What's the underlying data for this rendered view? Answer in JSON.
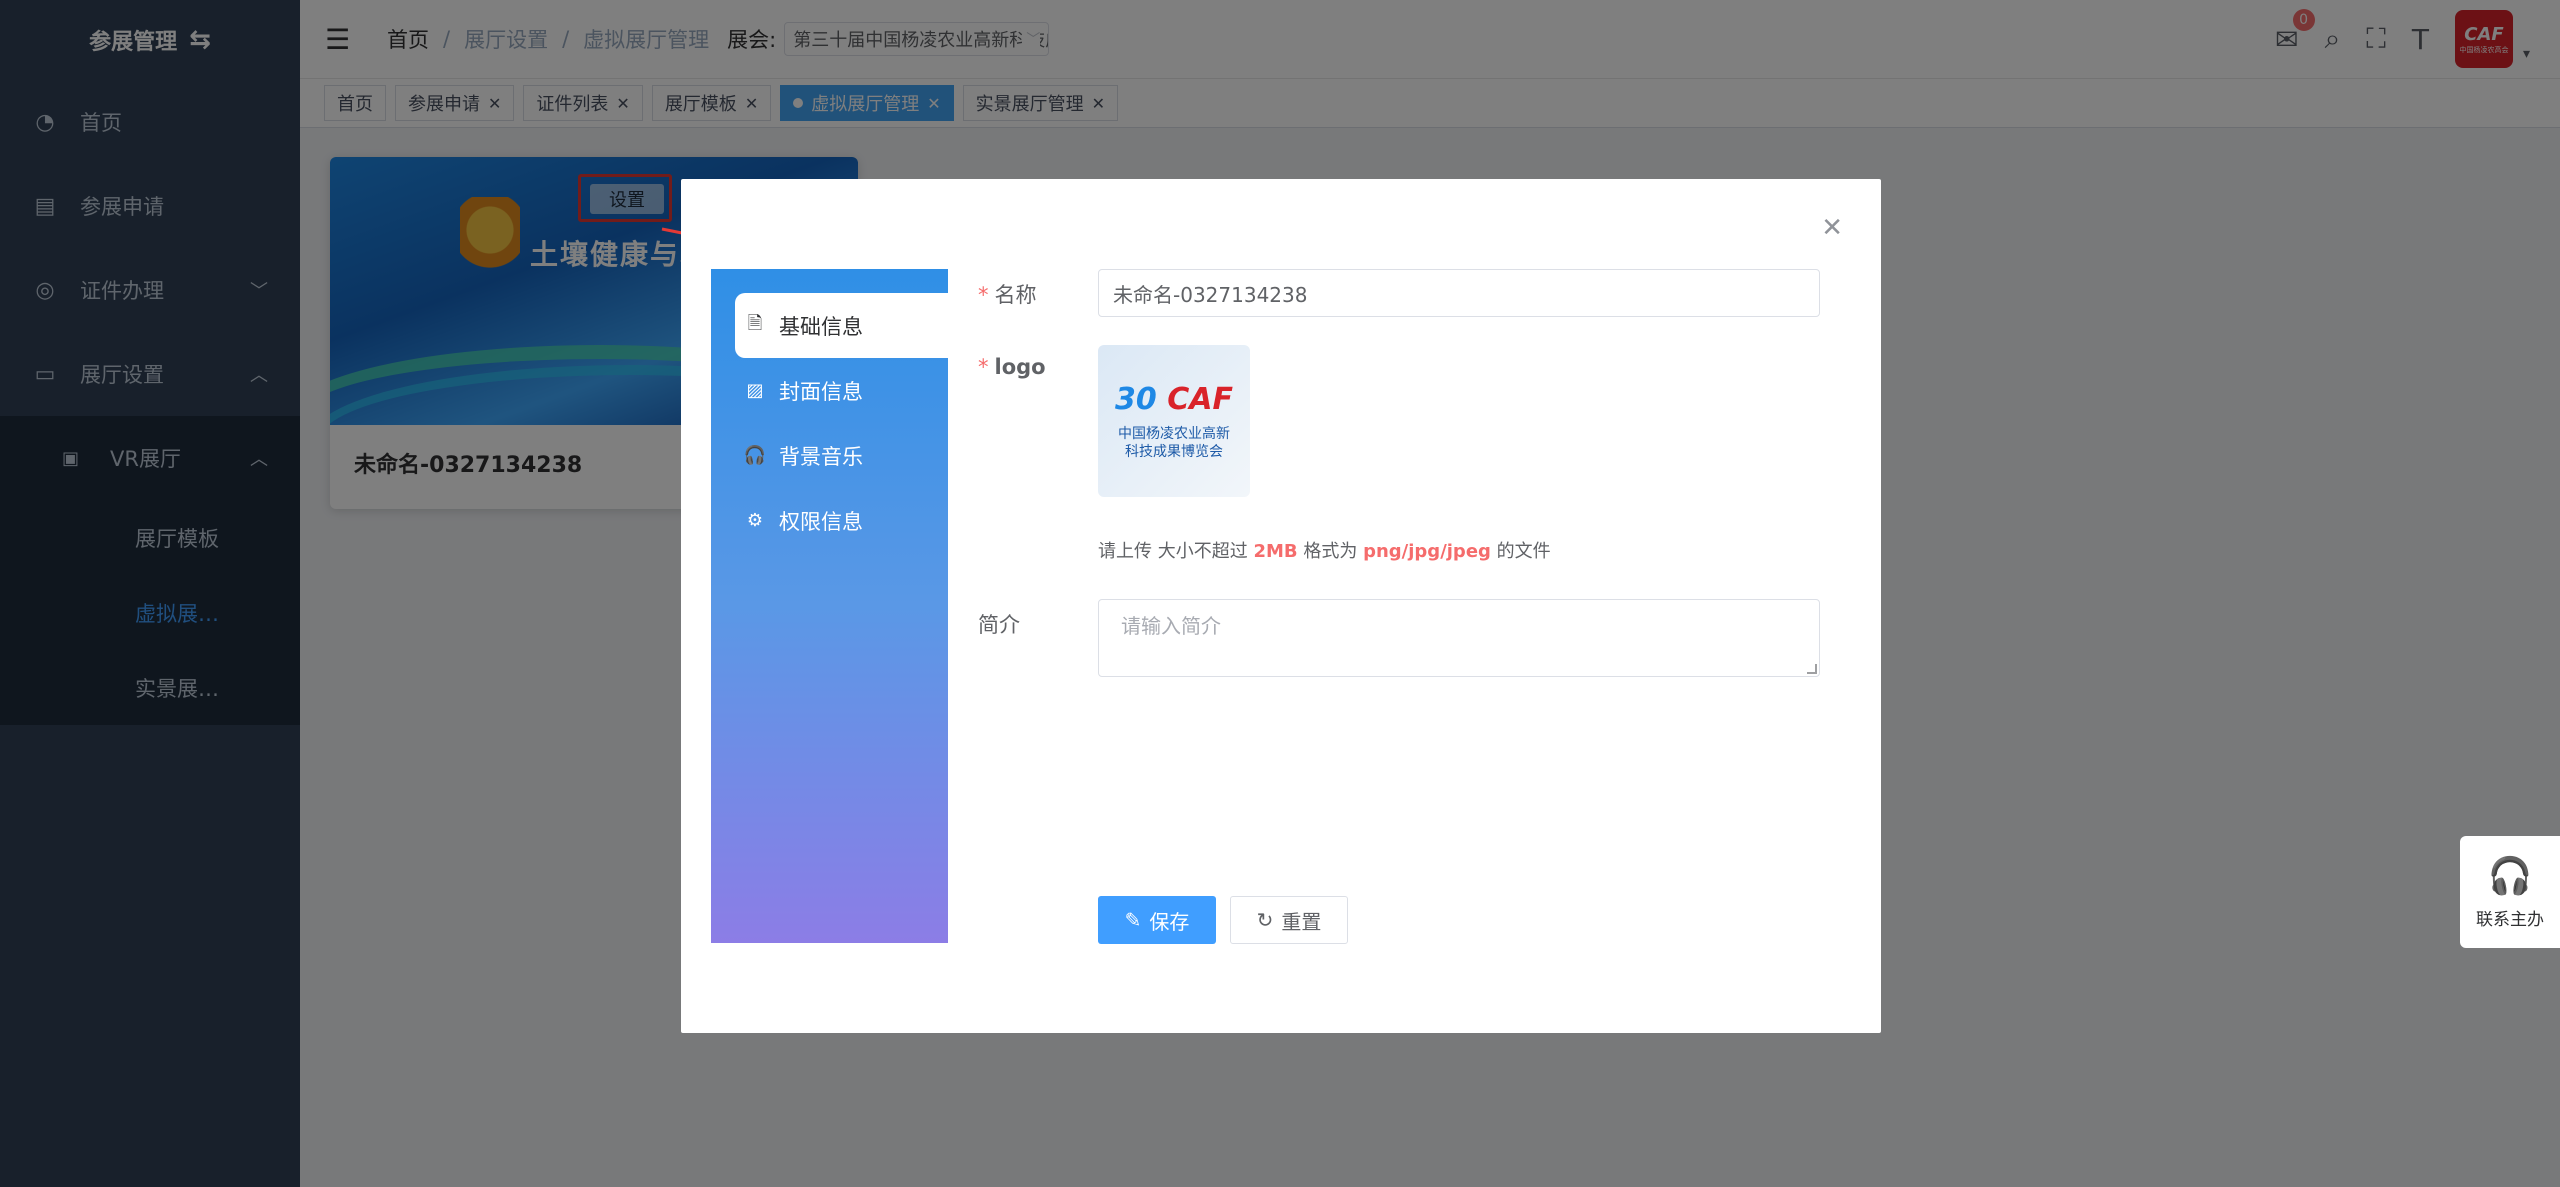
{
  "sidebar": {
    "title": "参展管理",
    "items": [
      {
        "label": "首页",
        "icon": "dashboard-icon"
      },
      {
        "label": "参展申请",
        "icon": "form-icon"
      },
      {
        "label": "证件办理",
        "icon": "badge-icon"
      },
      {
        "label": "展厅设置",
        "icon": "monitor-icon"
      }
    ],
    "sub": {
      "label": "VR展厅",
      "icon": "vr-icon"
    },
    "leaves": [
      "展厅模板",
      "虚拟展…",
      "实景展…"
    ]
  },
  "navbar": {
    "breadcrumb": [
      "首页",
      "展厅设置",
      "虚拟展厅管理"
    ],
    "expo_label": "展会:",
    "expo_value": "第三十届中国杨凌农业高新科技成果博览会",
    "mail_badge": "0",
    "avatar_text": "CAF",
    "avatar_sub": "中国杨凌农高会"
  },
  "tags": [
    {
      "label": "首页",
      "closable": false,
      "active": false
    },
    {
      "label": "参展申请",
      "closable": true,
      "active": false
    },
    {
      "label": "证件列表",
      "closable": true,
      "active": false
    },
    {
      "label": "展厅模板",
      "closable": true,
      "active": false
    },
    {
      "label": "虚拟展厅管理",
      "closable": true,
      "active": true
    },
    {
      "label": "实景展厅管理",
      "closable": true,
      "active": false
    }
  ],
  "card": {
    "banner": "土壤健康与粮食",
    "title": "未命名-0327134238",
    "set_label": "设置"
  },
  "dialog": {
    "nav": [
      {
        "label": "基础信息",
        "icon": "document-icon"
      },
      {
        "label": "封面信息",
        "icon": "image-icon"
      },
      {
        "label": "背景音乐",
        "icon": "headphones-icon"
      },
      {
        "label": "权限信息",
        "icon": "settings-icon"
      }
    ],
    "form": {
      "name_label": "名称",
      "name_value": "未命名-0327134238",
      "logo_label": "logo",
      "logo_text": "CAF",
      "logo_caption_1": "中国杨凌农业高新",
      "logo_caption_2": "科技成果博览会",
      "hint_pre": "请上传 大小不超过",
      "hint_size": "2MB",
      "hint_mid": "格式为",
      "hint_fmt": "png/jpg/jpeg",
      "hint_post": "的文件",
      "intro_label": "简介",
      "intro_placeholder": "请输入简介"
    },
    "save_label": "保存",
    "reset_label": "重置"
  },
  "contact": {
    "label": "联系主办"
  }
}
